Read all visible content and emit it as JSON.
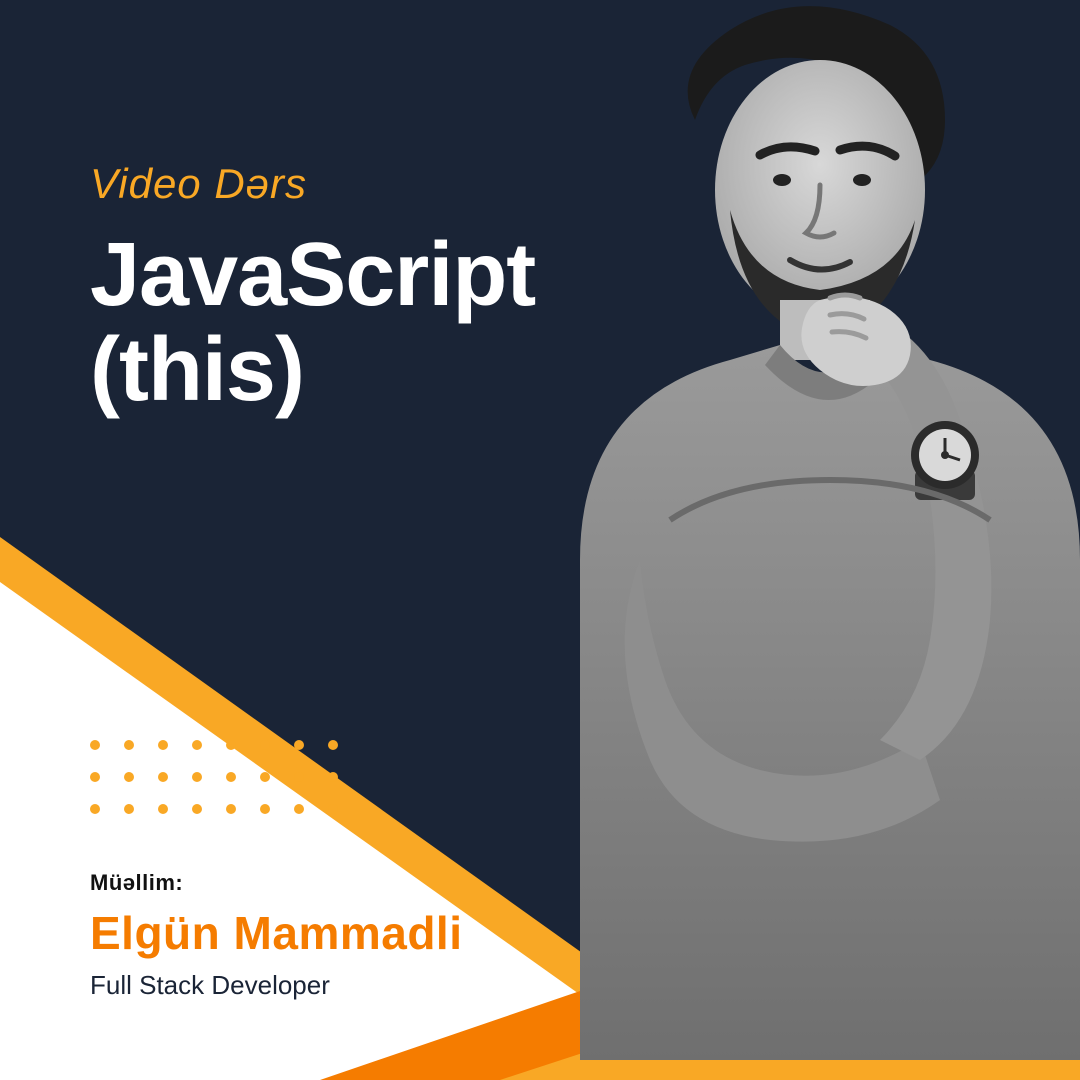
{
  "colors": {
    "bg": "#1a2436",
    "accent_light": "#f9a825",
    "accent_dark": "#f57c00",
    "white": "#ffffff",
    "text_dark": "#111111"
  },
  "headline": {
    "subtitle": "Video Dərs",
    "title_line1": "JavaScript",
    "title_line2": "(this)"
  },
  "teacher": {
    "label": "Müəllim:",
    "name": "Elgün Mammadli",
    "role": "Full Stack Developer"
  },
  "person_alt": "Instructor portrait, grayscale, arms crossed with hand on chin, wearing a wristwatch"
}
